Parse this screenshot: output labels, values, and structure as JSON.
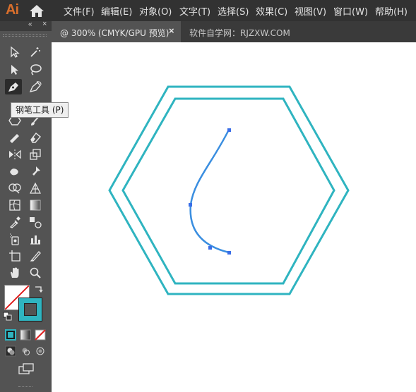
{
  "app": {
    "logo": "Ai"
  },
  "menu": {
    "items": [
      "文件(F)",
      "编辑(E)",
      "对象(O)",
      "文字(T)",
      "选择(S)",
      "效果(C)",
      "视图(V)",
      "窗口(W)",
      "帮助(H)"
    ]
  },
  "tabs": {
    "active_label": "@ 300% (CMYK/GPU 预览)",
    "close": "×",
    "inactive_label": "软件自学网：RJZXW.COM"
  },
  "toolbar": {
    "collapse": "«",
    "close": "×",
    "tooltip": "钢笔工具 (P)"
  },
  "colors": {
    "hexagon_stroke": "#2fb4c0",
    "path_stroke": "#3a8ee0",
    "anchor": "#3a6ee8",
    "accent_logo": "#d96f2c"
  }
}
